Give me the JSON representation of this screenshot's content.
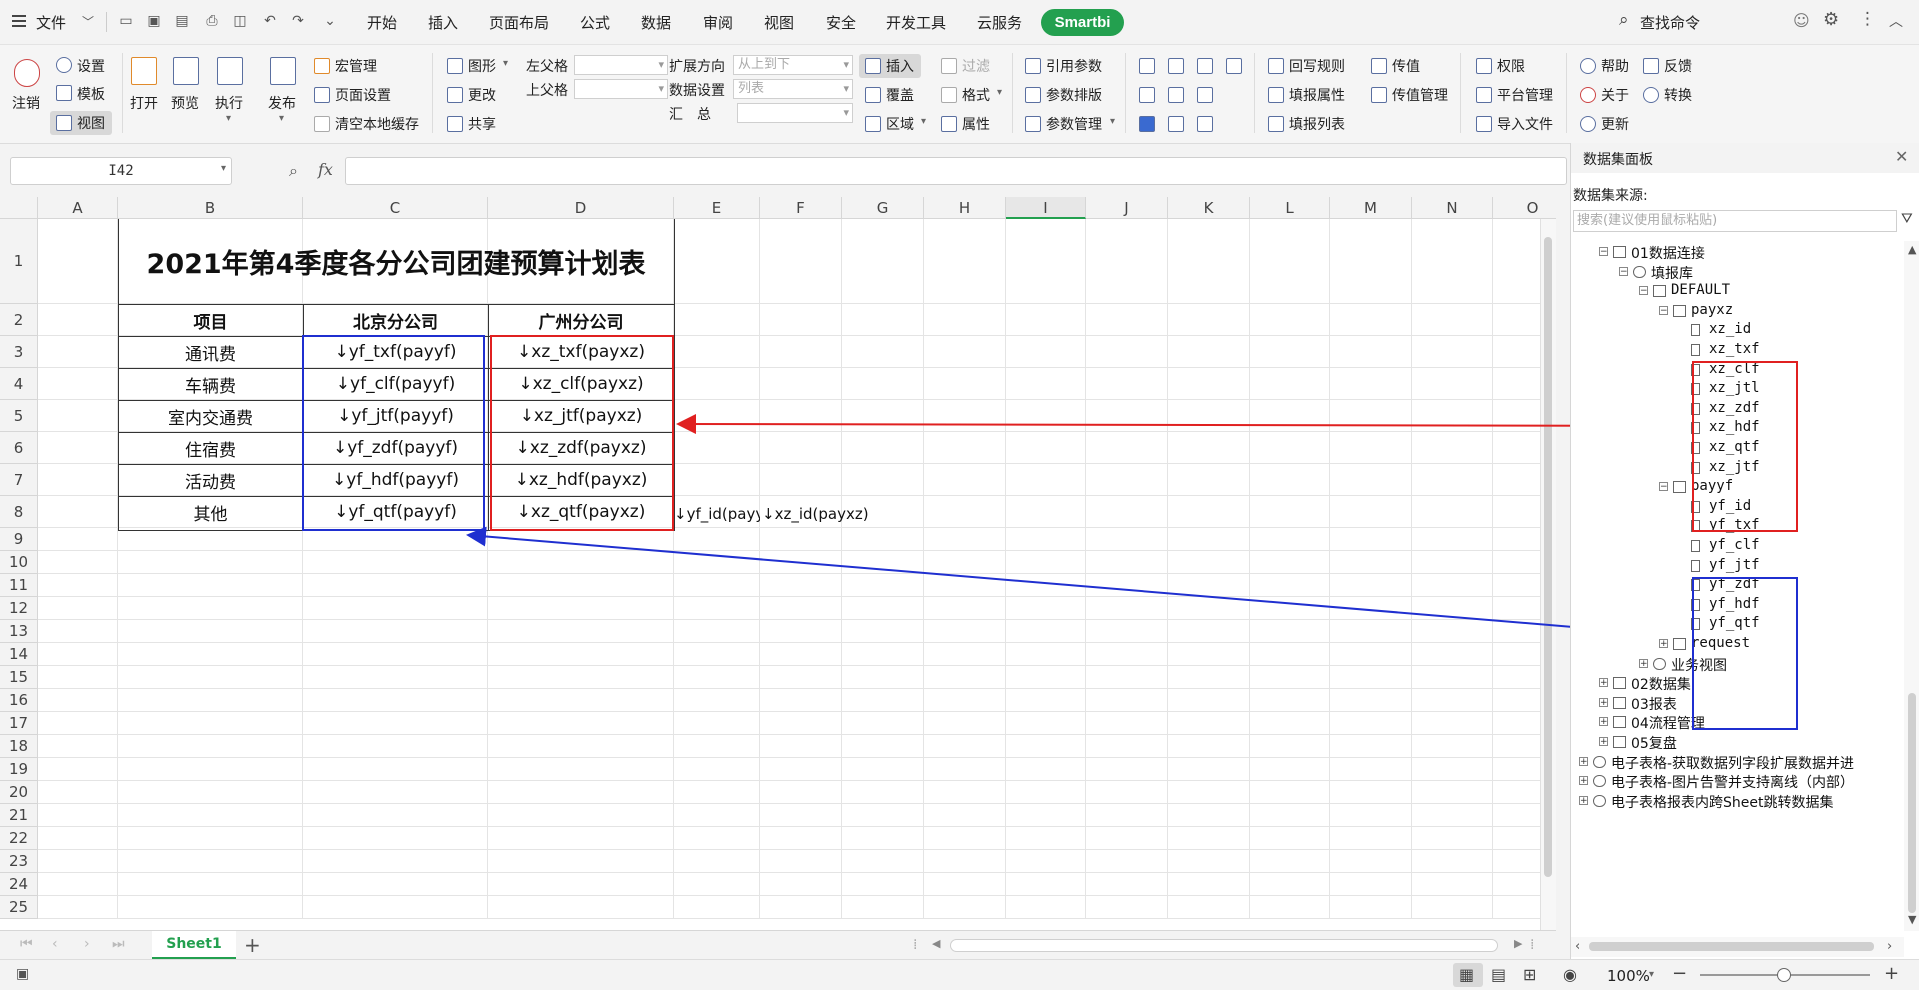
{
  "menubar": {
    "file_label": "文件",
    "tabs": [
      "开始",
      "插入",
      "页面布局",
      "公式",
      "数据",
      "审阅",
      "视图",
      "安全",
      "开发工具",
      "云服务"
    ],
    "smartbi_label": "Smartbi",
    "search_label": "查找命令"
  },
  "ribbon": {
    "logout": "注销",
    "settings": "设置",
    "template": "模板",
    "view": "视图",
    "open": "打开",
    "preview": "预览",
    "execute": "执行",
    "publish": "发布",
    "macro": "宏管理",
    "page_setup": "页面设置",
    "clear_cache": "清空本地缓存",
    "graphic": "图形",
    "change": "更改",
    "share": "共享",
    "left_parent": "左父格",
    "top_parent": "上父格",
    "expand_dir": "扩展方向",
    "expand_dir_value": "从上到下",
    "data_setting": "数据设置",
    "data_setting_value": "列表",
    "summary": "汇　总",
    "insert": "插入",
    "cover": "覆盖",
    "region": "区域",
    "filter": "过滤",
    "format": "格式",
    "property": "属性",
    "ref_param": "引用参数",
    "param_layout": "参数排版",
    "param_mgmt": "参数管理",
    "writeback_rule": "回写规则",
    "fill_prop": "填报属性",
    "fill_list": "填报列表",
    "pass_value": "传值",
    "pass_value_mgmt": "传值管理",
    "permission": "权限",
    "platform_mgmt": "平台管理",
    "import_file": "导入文件",
    "help": "帮助",
    "about": "关于",
    "update": "更新",
    "feedback": "反馈",
    "convert": "转换"
  },
  "formula": {
    "name_box": "I42",
    "fx": "fx"
  },
  "sheet": {
    "columns": [
      "A",
      "B",
      "C",
      "D",
      "E",
      "F",
      "G",
      "H",
      "I",
      "J",
      "K",
      "L",
      "M",
      "N",
      "O"
    ],
    "rows": [
      "1",
      "2",
      "3",
      "4",
      "5",
      "6",
      "7",
      "8",
      "9",
      "10",
      "11",
      "12",
      "13",
      "14",
      "15",
      "16",
      "17",
      "18",
      "19",
      "20",
      "21",
      "22",
      "23",
      "24",
      "25"
    ],
    "title": "2021年第4季度各分公司团建预算计划表",
    "headers": [
      "项目",
      "北京分公司",
      "广州分公司"
    ],
    "items": [
      "通讯费",
      "车辆费",
      "室内交通费",
      "住宿费",
      "活动费",
      "其他"
    ],
    "beijing": [
      "↓yf_txf(payyf)",
      "↓yf_clf(payyf)",
      "↓yf_jtf(payyf)",
      "↓yf_zdf(payyf)",
      "↓yf_hdf(payyf)",
      "↓yf_qtf(payyf)"
    ],
    "guangzhou": [
      "↓xz_txf(payxz)",
      "↓xz_clf(payxz)",
      "↓xz_jtf(payxz)",
      "↓xz_zdf(payxz)",
      "↓xz_hdf(payxz)",
      "↓xz_qtf(payxz)"
    ],
    "e8": "↓yf_id(payyf)",
    "f8": "↓xz_id(payxz)",
    "tab_name": "Sheet1"
  },
  "panel": {
    "title": "数据集面板",
    "source_label": "数据集来源:",
    "search_placeholder": "搜索(建议使用鼠标粘贴)",
    "tree": {
      "data_connection": "01数据连接",
      "fill_db": "填报库",
      "default": "DEFAULT",
      "payxz": "payxz",
      "payxz_fields": [
        "xz_id",
        "xz_txf",
        "xz_clf",
        "xz_jtl",
        "xz_zdf",
        "xz_hdf",
        "xz_qtf",
        "xz_jtf"
      ],
      "payyf": "payyf",
      "payyf_fields": [
        "yf_id",
        "yf_txf",
        "yf_clf",
        "yf_jtf",
        "yf_zdf",
        "yf_hdf",
        "yf_qtf"
      ],
      "request": "request",
      "business_view": "业务视图",
      "dataset": "02数据集",
      "report": "03报表",
      "workflow": "04流程管理",
      "review": "05复盘",
      "item1": "电子表格-获取数据列字段扩展数据并进",
      "item2": "电子表格-图片告警并支持离线（内部）",
      "item3": "电子表格报表内跨Sheet跳转数据集"
    }
  },
  "status": {
    "zoom": "100%"
  },
  "colors": {
    "smartbi": "#23a04f",
    "red_highlight": "#e02020",
    "blue_highlight": "#1f2fd0"
  }
}
